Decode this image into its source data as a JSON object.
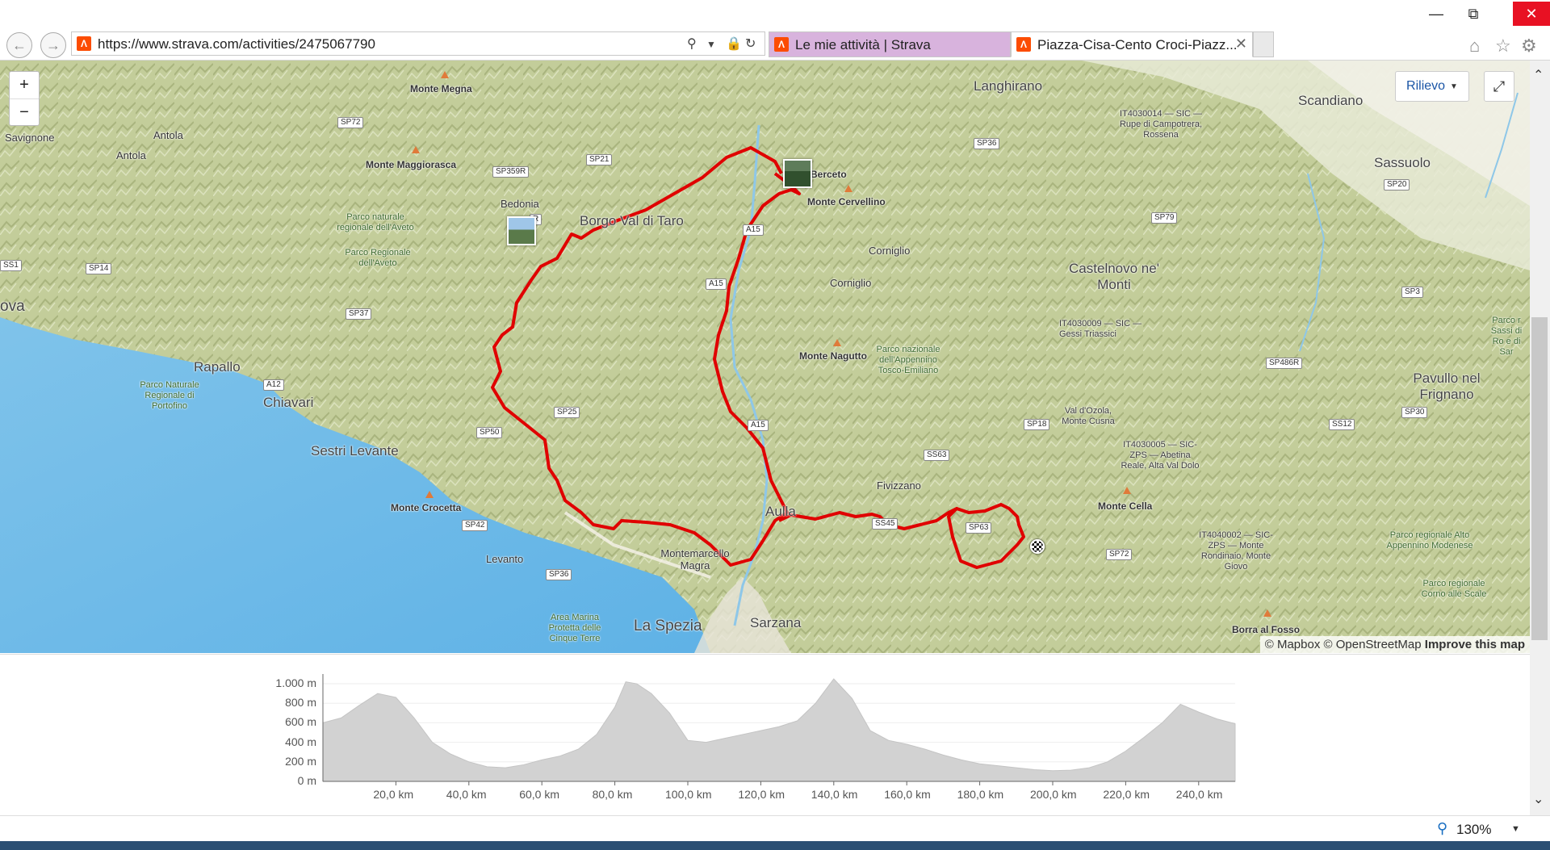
{
  "browser": {
    "url": "https://www.strava.com/activities/2475067790",
    "tabs": [
      {
        "label": "Le mie attività | Strava",
        "active": false
      },
      {
        "label": "Piazza-Cisa-Cento Croci-Piazz...",
        "active": true
      }
    ],
    "zoom_level": "130%",
    "tab_color": "#d8b3dd"
  },
  "map": {
    "layer_button": "Rilievo",
    "zoom_in": "+",
    "zoom_out": "−",
    "attribution": {
      "mapbox": "© Mapbox",
      "osm": "© OpenStreetMap",
      "improve": "Improve this map"
    },
    "route_color": "#e00000",
    "places": [
      {
        "id": "langhirano",
        "label": "Langhirano"
      },
      {
        "id": "scandiano",
        "label": "Scandiano"
      },
      {
        "id": "sassuolo",
        "label": "Sassuolo"
      },
      {
        "id": "monte-megna",
        "label": "Monte Megna"
      },
      {
        "id": "savignone",
        "label": "Savignone"
      },
      {
        "id": "antola",
        "label": "Antola"
      },
      {
        "id": "antola2",
        "label": "Antola"
      },
      {
        "id": "monte-maggiorasca",
        "label": "Monte Maggiorasca"
      },
      {
        "id": "bedonia",
        "label": "Bedonia"
      },
      {
        "id": "borgo-val-di-taro",
        "label": "Borgo Val di Taro"
      },
      {
        "id": "berceto",
        "label": "Berceto"
      },
      {
        "id": "monte-cervellino",
        "label": "Monte Cervellino"
      },
      {
        "id": "corniglio",
        "label": "Corniglio"
      },
      {
        "id": "corniglio2",
        "label": "Corniglio"
      },
      {
        "id": "castelnovo",
        "label": "Castelnovo ne' Monti"
      },
      {
        "id": "rapallo",
        "label": "Rapallo"
      },
      {
        "id": "chiavari",
        "label": "Chiavari"
      },
      {
        "id": "sestri-levante",
        "label": "Sestri Levante"
      },
      {
        "id": "monte-nagutto",
        "label": "Monte Nagutto"
      },
      {
        "id": "pavullo",
        "label": "Pavullo nel Frignano"
      },
      {
        "id": "fivizzano",
        "label": "Fivizzano"
      },
      {
        "id": "aulla",
        "label": "Aulla"
      },
      {
        "id": "monte-crocetta",
        "label": "Monte Crocetta"
      },
      {
        "id": "levanto",
        "label": "Levanto"
      },
      {
        "id": "montemarcello",
        "label": "Montemarcello Magra"
      },
      {
        "id": "la-spezia",
        "label": "La Spezia"
      },
      {
        "id": "sarzana",
        "label": "Sarzana"
      },
      {
        "id": "monte-cella",
        "label": "Monte Cella"
      },
      {
        "id": "borra",
        "label": "Borra al Fosso"
      },
      {
        "id": "ova",
        "label": "ova"
      }
    ],
    "parks": [
      {
        "id": "aveto1",
        "label": "Parco naturale regionale dell'Aveto"
      },
      {
        "id": "aveto2",
        "label": "Parco Regionale dell'Aveto"
      },
      {
        "id": "portofino",
        "label": "Parco Naturale Regionale di Portofino"
      },
      {
        "id": "appennino",
        "label": "Parco nazionale dell'Appennino Tosco-Emiliano"
      },
      {
        "id": "gessi",
        "label": "IT4030009 — SIC — Gessi Triassici"
      },
      {
        "id": "rossena",
        "label": "IT4030014 — SIC — Rupe di Campotrera, Rossena"
      },
      {
        "id": "ozola",
        "label": "Val d'Ozola, Monte Cusna"
      },
      {
        "id": "abetina",
        "label": "IT4030005 — SIC-ZPS — Abetina Reale, Alta Val Dolo"
      },
      {
        "id": "rondinaio",
        "label": "IT4040002 — SIC-ZPS — Monte Rondinaio, Monte Giovo"
      },
      {
        "id": "alto-app",
        "label": "Parco regionale Alto Appennino Modenese"
      },
      {
        "id": "corno",
        "label": "Parco regionale Corno alle Scale"
      },
      {
        "id": "cinque-terre",
        "label": "Area Marina Protetta delle Cinque Terre"
      },
      {
        "id": "sassi",
        "label": "Parco r Sassi di Ro e di Sar"
      }
    ],
    "roads": [
      "SP72",
      "SP21",
      "SP359R",
      "SP36",
      "SP79",
      "SP20",
      "A15",
      "A15",
      "SP14",
      "SP37",
      "SP3",
      "SP486R",
      "A12",
      "SP25",
      "SP50",
      "A15",
      "SP18",
      "SS63",
      "SS12",
      "SP30",
      "SP42",
      "SP36",
      "SS45",
      "SP72",
      "SS1",
      "R",
      "SP63"
    ]
  },
  "elevation": {
    "y_ticks": [
      "0 m",
      "200 m",
      "400 m",
      "600 m",
      "800 m",
      "1.000 m"
    ],
    "x_ticks": [
      "20,0 km",
      "40,0 km",
      "60,0 km",
      "80,0 km",
      "100,0 km",
      "120,0 km",
      "140,0 km",
      "160,0 km",
      "180,0 km",
      "200,0 km",
      "220,0 km",
      "240,0 km"
    ],
    "profile_km": [
      0,
      5,
      10,
      15,
      20,
      25,
      30,
      35,
      40,
      45,
      50,
      55,
      60,
      65,
      70,
      75,
      80,
      83,
      86,
      90,
      95,
      100,
      105,
      110,
      115,
      120,
      125,
      130,
      135,
      140,
      145,
      150,
      155,
      160,
      165,
      170,
      175,
      180,
      185,
      190,
      195,
      200,
      205,
      210,
      215,
      220,
      225,
      230,
      235,
      240,
      245,
      250
    ],
    "profile_m": [
      600,
      650,
      780,
      900,
      860,
      650,
      400,
      280,
      200,
      150,
      140,
      170,
      220,
      260,
      330,
      480,
      760,
      1020,
      1000,
      900,
      700,
      420,
      400,
      440,
      480,
      520,
      560,
      620,
      800,
      1050,
      850,
      520,
      420,
      380,
      330,
      270,
      220,
      180,
      160,
      140,
      120,
      110,
      115,
      140,
      200,
      310,
      450,
      600,
      790,
      710,
      640,
      590
    ],
    "km_max": 250,
    "m_max": 1050
  }
}
